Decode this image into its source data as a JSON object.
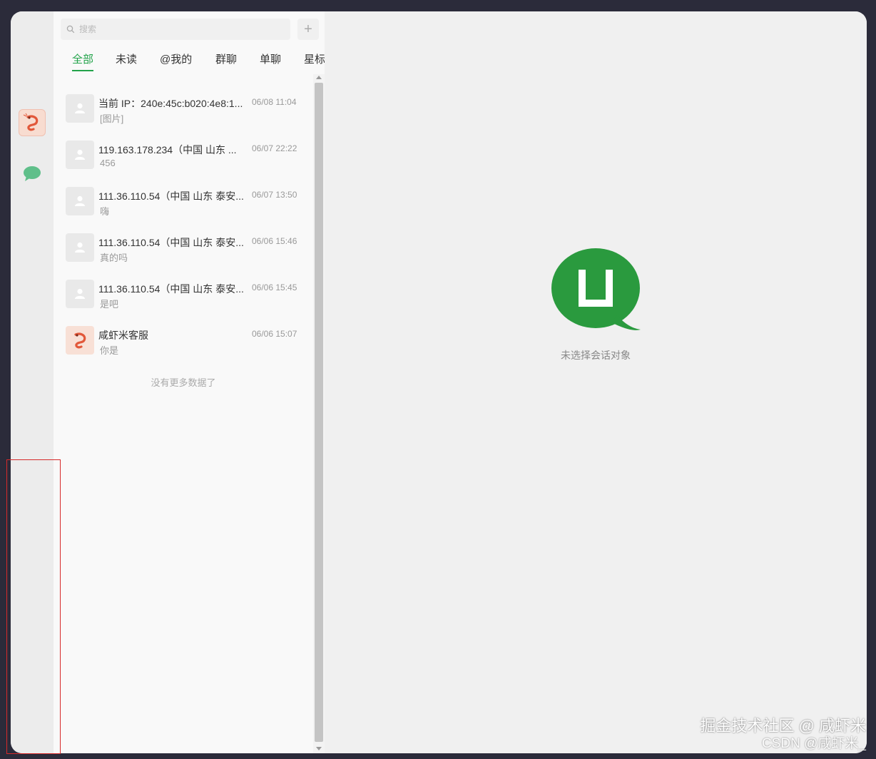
{
  "search": {
    "placeholder": "搜索",
    "add_label": "+"
  },
  "tabs": [
    {
      "label": "全部",
      "active": true
    },
    {
      "label": "未读"
    },
    {
      "label": "@我的"
    },
    {
      "label": "群聊"
    },
    {
      "label": "单聊"
    },
    {
      "label": "星标"
    }
  ],
  "conversations": [
    {
      "title": "当前 IP：240e:45c:b020:4e8:1...",
      "time": "06/08 11:04",
      "preview": "[图片]",
      "avatar": "user-placeholder-icon"
    },
    {
      "title": "119.163.178.234（中国 山东 ...",
      "time": "06/07 22:22",
      "preview": "456",
      "avatar": "user-placeholder-icon"
    },
    {
      "title": "111.36.110.54（中国 山东 泰安...",
      "time": "06/07 13:50",
      "preview": "嗨",
      "avatar": "user-placeholder-icon"
    },
    {
      "title": "111.36.110.54（中国 山东 泰安...",
      "time": "06/06 15:46",
      "preview": "真的吗",
      "avatar": "user-placeholder-icon"
    },
    {
      "title": "111.36.110.54（中国 山东 泰安...",
      "time": "06/06 15:45",
      "preview": "是吧",
      "avatar": "user-placeholder-icon"
    },
    {
      "title": "咸虾米客服",
      "time": "06/06 15:07",
      "preview": "你是",
      "avatar": "shrimp-avatar"
    }
  ],
  "list": {
    "no_more": "没有更多数据了"
  },
  "main": {
    "empty_text": "未选择会话对象"
  },
  "watermark": {
    "line1": "掘金技术社区 @ 咸虾米",
    "line2": "CSDN @咸虾米_"
  },
  "colors": {
    "accent": "#22a34a",
    "logo_green": "#2a9a3e",
    "chat_icon": "#5fbf8a",
    "highlight": "#d62a2a"
  }
}
